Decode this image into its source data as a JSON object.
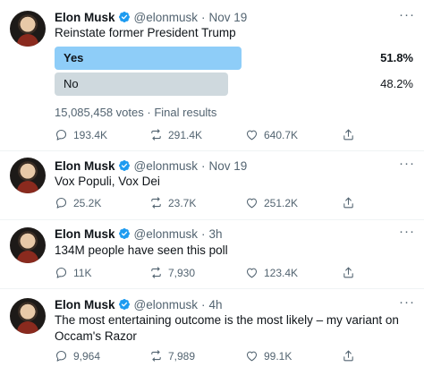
{
  "tweets": [
    {
      "name": "Elon Musk",
      "handle": "@elonmusk",
      "time": "Nov 19",
      "text": "Reinstate former President Trump",
      "poll": {
        "options": [
          {
            "label": "Yes",
            "percent": "51.8%",
            "share": 0.518,
            "winner": true
          },
          {
            "label": "No",
            "percent": "48.2%",
            "share": 0.482,
            "winner": false
          }
        ],
        "votes": "15,085,458 votes",
        "status": "Final results"
      },
      "stats": {
        "replies": "193.4K",
        "retweets": "291.4K",
        "likes": "640.7K"
      }
    },
    {
      "name": "Elon Musk",
      "handle": "@elonmusk",
      "time": "Nov 19",
      "text": "Vox Populi, Vox Dei",
      "stats": {
        "replies": "25.2K",
        "retweets": "23.7K",
        "likes": "251.2K"
      }
    },
    {
      "name": "Elon Musk",
      "handle": "@elonmusk",
      "time": "3h",
      "text": "134M people have seen this poll",
      "stats": {
        "replies": "11K",
        "retweets": "7,930",
        "likes": "123.4K"
      }
    },
    {
      "name": "Elon Musk",
      "handle": "@elonmusk",
      "time": "4h",
      "text": "The most entertaining outcome is the most likely – my variant on Occam's Razor",
      "stats": {
        "replies": "9,964",
        "retweets": "7,989",
        "likes": "99.1K"
      }
    }
  ],
  "separator": "·",
  "icons": {
    "verified": "verified-badge-icon",
    "more": "more-options-icon",
    "reply": "reply-icon",
    "retweet": "retweet-icon",
    "like": "like-icon",
    "share": "share-icon"
  },
  "colors": {
    "verified": "#1d9bf0",
    "poll_winner": "#8ecdf8",
    "poll_other": "#cfd9de",
    "secondary_text": "#536471"
  }
}
